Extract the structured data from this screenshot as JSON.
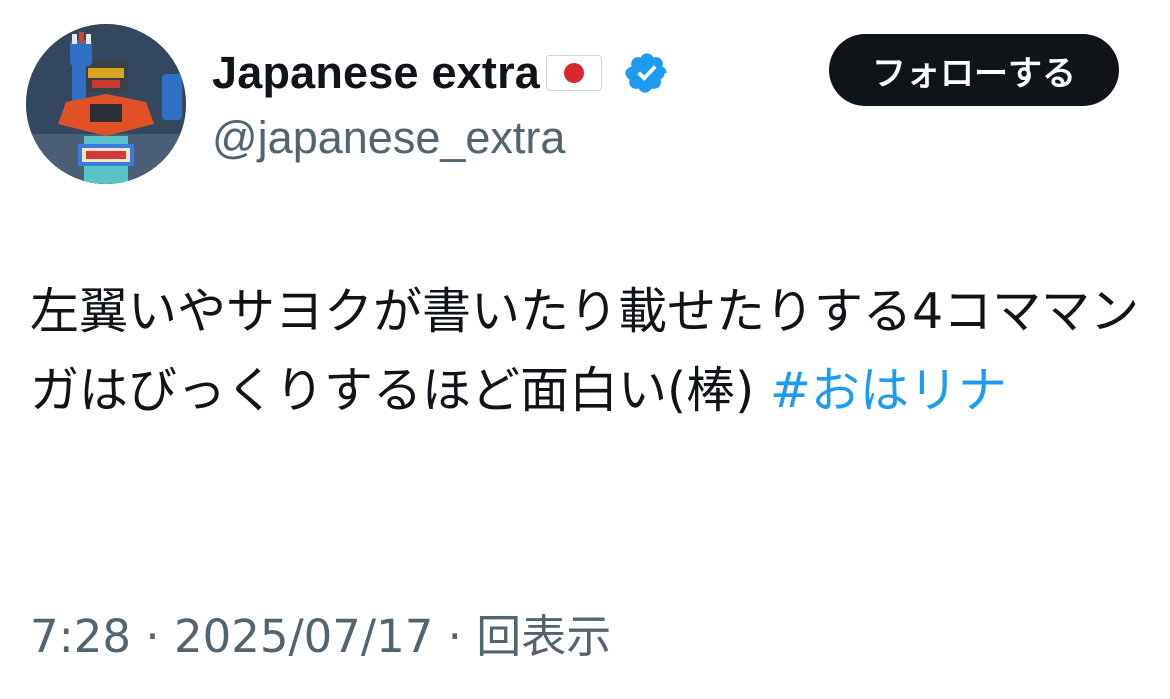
{
  "profile": {
    "display_name": "Japanese extra",
    "flag_icon": "japan-flag-icon",
    "verified_icon": "verified-badge-icon",
    "verified_color": "#1d9bf0",
    "handle": "@japanese_extra",
    "avatar": "robot-figure-avatar"
  },
  "follow_button": {
    "label": "フォローする"
  },
  "tweet": {
    "text": "左翼いやサヨクが書いたり載せたりする4コママンガはびっくりするほど面白い(棒) ",
    "hashtag": "#おはリナ",
    "hashtag_color": "#1d9bf0"
  },
  "meta": {
    "time": "7:28",
    "sep1": " · ",
    "date": "2025/07/17",
    "sep2": " · ",
    "views": "回表示"
  }
}
